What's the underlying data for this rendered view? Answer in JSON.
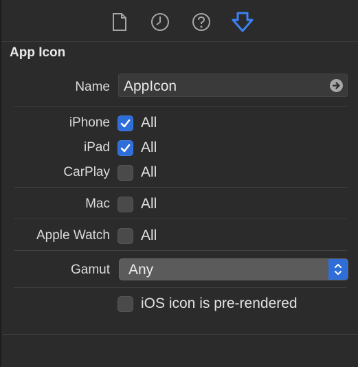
{
  "toolbar": {
    "icons": [
      "file-icon",
      "history-icon",
      "help-icon",
      "attributes-inspector-icon"
    ],
    "active_color": "#3b82f6",
    "inactive_color": "#a6a6a6"
  },
  "section": {
    "title": "App Icon"
  },
  "name_field": {
    "label": "Name",
    "value": "AppIcon",
    "button_icon": "arrow-right-circle-icon"
  },
  "devices": [
    {
      "label": "iPhone",
      "checkbox_label": "All",
      "checked": true
    },
    {
      "label": "iPad",
      "checkbox_label": "All",
      "checked": true
    },
    {
      "label": "CarPlay",
      "checkbox_label": "All",
      "checked": false
    },
    {
      "label": "Mac",
      "checkbox_label": "All",
      "checked": false
    },
    {
      "label": "Apple Watch",
      "checkbox_label": "All",
      "checked": false
    }
  ],
  "gamut": {
    "label": "Gamut",
    "value": "Any",
    "caret_icon": "up-down-chevron-icon"
  },
  "prerendered": {
    "label": "iOS icon is pre-rendered",
    "checked": false
  },
  "colors": {
    "accent": "#2f6ed8",
    "background": "#2b2b2b"
  }
}
